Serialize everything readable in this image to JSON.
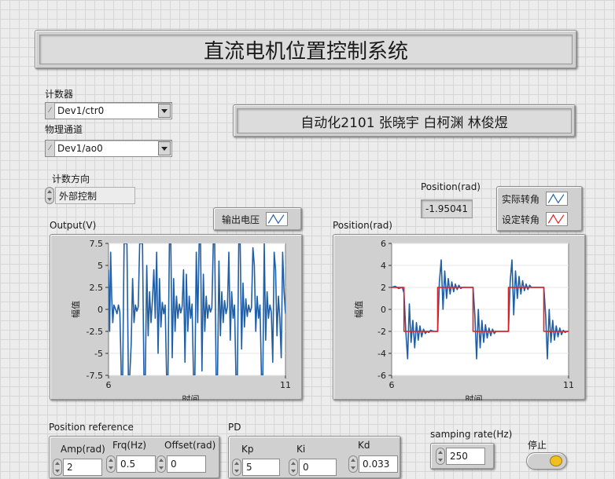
{
  "title": "直流电机位置控制系统",
  "authors": "自动化2101 张晓宇 白柯渊 林俊煜",
  "counter": {
    "label": "计数器",
    "value": "Dev1/ctr0",
    "tag": "I/O"
  },
  "channel": {
    "label": "物理通道",
    "value": "Dev1/ao0",
    "tag": "I/O"
  },
  "direction": {
    "label": "计数方向",
    "value": "外部控制"
  },
  "position_indicator": {
    "label": "Position(rad)",
    "value": "-1.95041"
  },
  "output_legend": {
    "label": "输出电压",
    "color": "#1f5fa8"
  },
  "position_legend": {
    "items": [
      {
        "label": "实际转角",
        "color": "#1f5fa8"
      },
      {
        "label": "设定转角",
        "color": "#e02020"
      }
    ]
  },
  "chart_data": [
    {
      "type": "line",
      "title": "Output(V)",
      "xlabel": "时间",
      "ylabel": "幅值",
      "xlim": [
        6,
        11
      ],
      "ylim": [
        -7.5,
        7.5
      ],
      "xticks": [
        "6",
        "11"
      ],
      "yticks": [
        "7.5",
        "5",
        "2.5",
        "0",
        "-2.5",
        "-5",
        "-7.5"
      ],
      "series": [
        {
          "name": "输出电压",
          "color": "#1f5fa8",
          "x": [
            6.0,
            6.03,
            6.06,
            6.09,
            6.12,
            6.15,
            6.2,
            6.24,
            6.28,
            6.32,
            6.36,
            6.4,
            6.44,
            6.48,
            6.52,
            6.56,
            6.6,
            6.64,
            6.68,
            6.72,
            6.76,
            6.8,
            6.84,
            6.88,
            6.92,
            6.96,
            7.0,
            7.04,
            7.08,
            7.12,
            7.16,
            7.2,
            7.24,
            7.28,
            7.32,
            7.36,
            7.4,
            7.44,
            7.48,
            7.52,
            7.56,
            7.6,
            7.64,
            7.68,
            7.72,
            7.76,
            7.8,
            7.84,
            7.88,
            7.92,
            7.96,
            8.0,
            8.04,
            8.08,
            8.12,
            8.16,
            8.2,
            8.24,
            8.28,
            8.32,
            8.36,
            8.4,
            8.44,
            8.48,
            8.52,
            8.56,
            8.6,
            8.64,
            8.68,
            8.72,
            8.76,
            8.8,
            8.84,
            8.88,
            8.92,
            8.96,
            9.0,
            9.04,
            9.08,
            9.12,
            9.16,
            9.2,
            9.24,
            9.28,
            9.32,
            9.36,
            9.4,
            9.44,
            9.48,
            9.52,
            9.56,
            9.6,
            9.64,
            9.68,
            9.72,
            9.76,
            9.8,
            9.84,
            9.88,
            9.92,
            9.96,
            10.0,
            10.04,
            10.08,
            10.12,
            10.16,
            10.2,
            10.24,
            10.28,
            10.32,
            10.36,
            10.4,
            10.44,
            10.48,
            10.52,
            10.56,
            10.6,
            10.64,
            10.68,
            10.72,
            10.76,
            10.8,
            10.84,
            10.88,
            10.92,
            10.96,
            11.0
          ],
          "values": [
            4.5,
            -2.5,
            6.5,
            1.5,
            -1.5,
            0.5,
            0,
            -0.5,
            0.5,
            -0.3,
            -7.5,
            -7.5,
            7.5,
            7.5,
            7.5,
            -7.5,
            -7.5,
            -4,
            3.5,
            -1.5,
            0.5,
            -0.2,
            0.3,
            7.5,
            7.5,
            7.5,
            -7.5,
            -7.5,
            5,
            -3,
            2,
            -1.5,
            1,
            4.5,
            -1,
            6.5,
            -5,
            3.5,
            -2,
            0.8,
            -0.5,
            0.5,
            -7.5,
            -7.5,
            7.5,
            7.5,
            -5.5,
            3.5,
            -2.5,
            1.5,
            -1,
            0.6,
            -0.4,
            0.3,
            4.5,
            -6,
            4,
            -2.5,
            1.5,
            -1,
            0.6,
            -7.5,
            -7.5,
            6.5,
            -1.5,
            7.5,
            7.5,
            -7,
            4,
            -2.5,
            1.5,
            -1,
            0.5,
            -0.3,
            0.2,
            7.5,
            7.5,
            -7.5,
            -7.5,
            5.5,
            -3,
            2,
            -1.5,
            1,
            -0.5,
            0.3,
            6.5,
            -3.5,
            2,
            -1,
            0.5,
            -7.5,
            -7.5,
            7.5,
            7.5,
            -4.5,
            3,
            -2,
            1.2,
            -0.8,
            0.5,
            -0.3,
            0.2,
            7,
            5,
            -2.5,
            1.5,
            -1,
            0.5,
            -7.5,
            -7.5,
            7.5,
            -3.5,
            2,
            -1,
            0.5,
            -0.3,
            -6,
            6.5,
            4.5,
            -3,
            1.5,
            -1,
            -5.5,
            6.5,
            2,
            -0.5
          ]
        }
      ]
    },
    {
      "type": "line",
      "title": "Position(rad)",
      "xlabel": "时间",
      "ylabel": "幅值",
      "xlim": [
        6,
        11
      ],
      "ylim": [
        -6,
        6
      ],
      "xticks": [
        "6",
        "11"
      ],
      "yticks": [
        "6",
        "4",
        "2",
        "0",
        "-2",
        "-4",
        "-6"
      ],
      "series": [
        {
          "name": "实际转角",
          "color": "#1f5fa8",
          "x": [
            6.0,
            6.1,
            6.2,
            6.3,
            6.35,
            6.4,
            6.45,
            6.5,
            6.55,
            6.6,
            6.65,
            6.7,
            6.75,
            6.8,
            6.85,
            6.9,
            6.95,
            7.0,
            7.05,
            7.1,
            7.2,
            7.3,
            7.35,
            7.4,
            7.45,
            7.5,
            7.55,
            7.6,
            7.65,
            7.7,
            7.75,
            7.8,
            7.85,
            7.9,
            7.95,
            8.0,
            8.1,
            8.2,
            8.3,
            8.35,
            8.4,
            8.45,
            8.5,
            8.55,
            8.6,
            8.65,
            8.7,
            8.75,
            8.8,
            8.85,
            8.9,
            8.95,
            9.0,
            9.1,
            9.2,
            9.3,
            9.35,
            9.4,
            9.45,
            9.5,
            9.55,
            9.6,
            9.65,
            9.7,
            9.75,
            9.8,
            9.85,
            9.9,
            9.95,
            10.0,
            10.1,
            10.2,
            10.3,
            10.35,
            10.4,
            10.45,
            10.5,
            10.55,
            10.6,
            10.65,
            10.7,
            10.75,
            10.8,
            10.85,
            10.9,
            10.95,
            11.0
          ],
          "values": [
            2,
            2.1,
            1.9,
            2,
            1.5,
            -2,
            -4.5,
            0.5,
            -3,
            -1,
            -3.5,
            -1.2,
            -2.8,
            -1.5,
            -2.5,
            -1.8,
            -2.2,
            -2,
            -2.1,
            -1.9,
            -2,
            -2,
            2.5,
            4.5,
            0,
            3.5,
            1,
            2.8,
            1.4,
            2.5,
            1.6,
            2.3,
            1.8,
            2.2,
            1.9,
            2,
            2,
            2,
            2,
            -0.5,
            -4.5,
            0,
            -3.5,
            -1,
            -3,
            -1.4,
            -2.6,
            -1.7,
            -2.4,
            -1.8,
            -2.2,
            -2,
            -2,
            -2,
            -2,
            -2,
            2.5,
            4.5,
            -0.5,
            3.5,
            1,
            3,
            1.4,
            2.6,
            1.7,
            2.3,
            1.8,
            2.2,
            2,
            2,
            2,
            2,
            2,
            -0.5,
            -4.5,
            0,
            -3,
            -1,
            -2.8,
            -1.5,
            -2.5,
            -1.7,
            -2.3,
            -1.9,
            -2.1,
            -2,
            -2
          ]
        },
        {
          "name": "设定转角",
          "color": "#e02020",
          "x": [
            6.0,
            6.35,
            6.35,
            7.3,
            7.3,
            8.3,
            8.3,
            9.3,
            9.3,
            10.3,
            10.3,
            11.0
          ],
          "values": [
            2,
            2,
            -2,
            -2,
            2,
            2,
            -2,
            -2,
            2,
            2,
            -2,
            -2
          ]
        }
      ]
    }
  ],
  "position_reference": {
    "label": "Position reference",
    "amp": {
      "label": "Amp(rad)",
      "value": "2"
    },
    "freq": {
      "label": "Frq(Hz)",
      "value": "0.5"
    },
    "offset": {
      "label": "Offset(rad)",
      "value": "0"
    }
  },
  "pd": {
    "label": "PD",
    "kp": {
      "label": "Kp",
      "value": "5"
    },
    "ki": {
      "label": "Ki",
      "value": "0"
    },
    "kd": {
      "label": "Kd",
      "value": "0.033"
    }
  },
  "sampling": {
    "label": "samping rate(Hz)",
    "value": "250"
  },
  "stop": {
    "label": "停止"
  }
}
